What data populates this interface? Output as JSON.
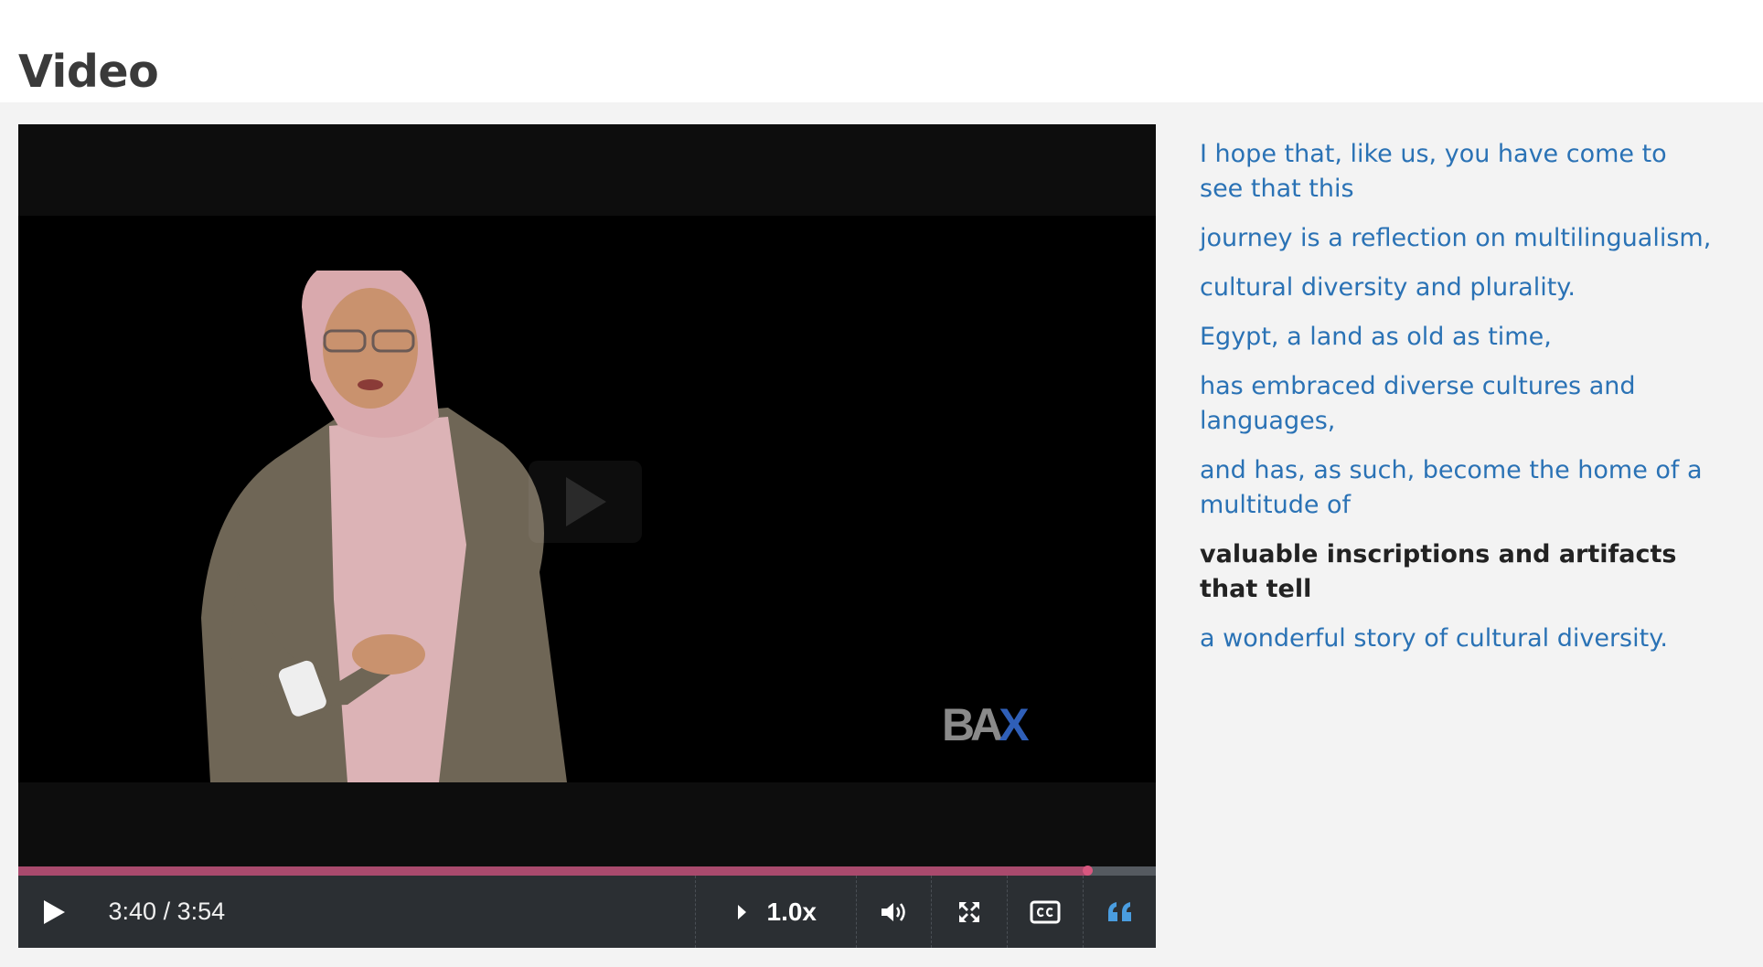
{
  "page": {
    "title": "Video"
  },
  "video": {
    "time": "3:40 / 3:54",
    "progress_fraction": 0.94,
    "speed": "1.0x",
    "logo_ba": "BA",
    "logo_x": "X"
  },
  "transcript": [
    {
      "text": "I hope that, like us, you have come to see that this",
      "active": false
    },
    {
      "text": "journey is a reflection on multilingualism,",
      "active": false
    },
    {
      "text": "cultural diversity and plurality.",
      "active": false
    },
    {
      "text": "Egypt, a land as old as time,",
      "active": false
    },
    {
      "text": "has embraced diverse cultures and languages,",
      "active": false
    },
    {
      "text": "and has, as such, become the home of a multitude of",
      "active": false
    },
    {
      "text": "valuable inscriptions and artifacts that tell",
      "active": true
    },
    {
      "text": "a wonderful story of cultural diversity.",
      "active": false
    }
  ],
  "colors": {
    "link": "#2a72b5",
    "progress": "#a94a6d",
    "controls_bg": "#2b2f33",
    "accent_icon": "#4a9de0"
  },
  "icons": [
    "play-icon",
    "chevron-right-icon",
    "volume-icon",
    "fullscreen-icon",
    "closed-captions-icon",
    "quote-icon"
  ]
}
